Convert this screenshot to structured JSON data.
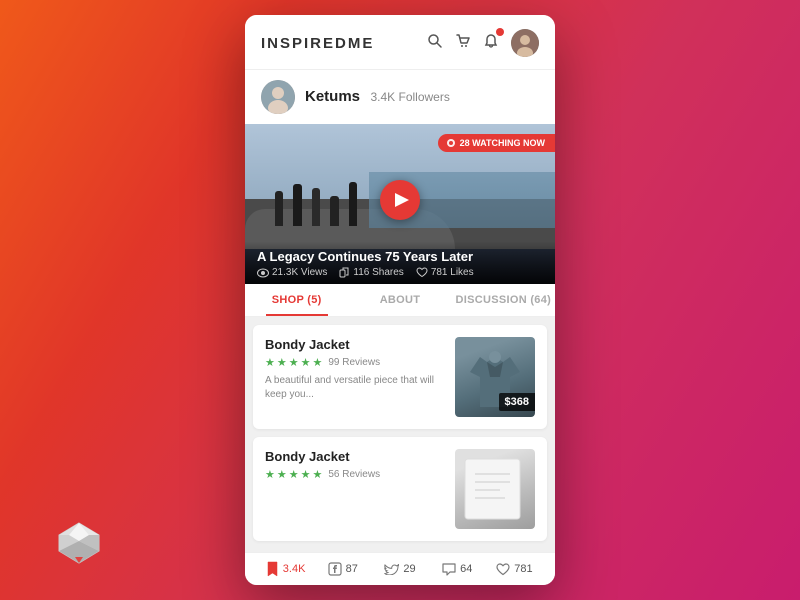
{
  "app": {
    "logo": "INSPIREDME"
  },
  "header": {
    "search_icon": "🔍",
    "cart_icon": "🛒",
    "notif_icon": "🔔",
    "avatar_label": "U"
  },
  "user": {
    "name": "Ketums",
    "followers": "3.4K Followers",
    "avatar_label": "K"
  },
  "video": {
    "watching_badge": "28 WATCHING NOW",
    "title": "A Legacy Continues 75 Years Later",
    "views": "21.3K Views",
    "shares": "116 Shares",
    "likes": "781 Likes"
  },
  "tabs": [
    {
      "label": "SHOP (5)",
      "active": true
    },
    {
      "label": "ABOUT",
      "active": false
    },
    {
      "label": "DISCUSSION (64)",
      "active": false
    }
  ],
  "products": [
    {
      "name": "Bondy Jacket",
      "reviews": "99 Reviews",
      "description": "A beautiful and versatile piece that will keep you...",
      "price": "$368",
      "stars": [
        1,
        1,
        1,
        1,
        0.5
      ]
    },
    {
      "name": "Bondy Jacket",
      "reviews": "56 Reviews",
      "description": "",
      "price": "",
      "stars": [
        1,
        1,
        1,
        1,
        0.5
      ]
    }
  ],
  "bottom_bar": {
    "saves": "3.4K",
    "facebook": "87",
    "twitter": "29",
    "comments": "64",
    "likes": "781"
  }
}
